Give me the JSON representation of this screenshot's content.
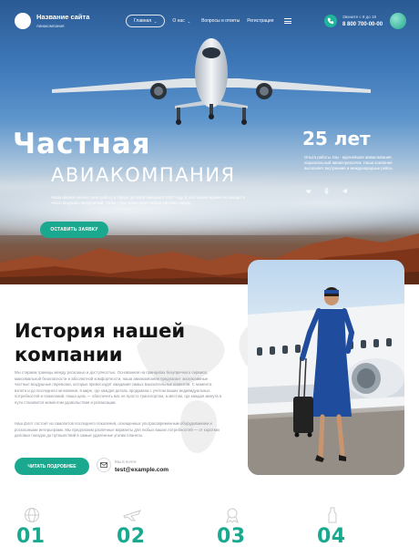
{
  "header": {
    "site_name": "Название сайта",
    "site_slogan": "Авиакомпания",
    "nav": [
      {
        "label": "Главная"
      },
      {
        "label": "О нас"
      },
      {
        "label": "Вопросы и ответы"
      },
      {
        "label": "Регистрация"
      }
    ],
    "phone_label": "Звоните с 9 до 18",
    "phone_number": "8 800 700-00-00"
  },
  "hero": {
    "title_line1": "Частная",
    "title_line2": "АВИАКОМПАНИЯ",
    "description": "Наша фирма начала свою работу в сфере деловой авиации в 2007 году. В настоящее время она входит в число ведущих предприятий. Также у нас существует гибкая система скидок.",
    "cta_label": "ОСТАВИТЬ ЗАЯВКУ",
    "years": "25 лет",
    "years_desc": "Опыта работы. Мы - крупнейшая авиакомпания, национальный авиаперевозчик. Наша компания выполняет внутренние и международные рейсы"
  },
  "history": {
    "title": "История нашей компании",
    "paragraph1": "Мы стираем границы между роскошью и доступностью. Основанная на принципах безупречного сервиса, максимальной безопасности и абсолютной комфортности, наша авиакомпания предлагает эксклюзивные частные воздушные перевозки, которые превосходят ожидания самых взыскательных клиентов. С момента взлета и до последнего мгновения, в мире, где каждая деталь продумана с учетом ваших индивидуальных потребностей и пожеланий. Наша цель — обеспечить вас не просто транспортом, а местом, где каждая минута в пути становится моментом удовольствия и релаксации.",
    "paragraph2": "Наш флот состоит из самолетов последнего поколения, оснащенных ультрасовременным оборудованием и роскошными интерьерами. Мы предлагаем различные варианты для любых ваших потребностей — от коротких деловых поездок до путешествий в самые удаленные уголки планеты.",
    "read_more_label": "ЧИТАТЬ ПОДРОБНЕЕ",
    "mail_label": "Мы в почте",
    "mail_address": "test@example.com"
  },
  "numbers": [
    {
      "value": "01",
      "icon": "globe-icon"
    },
    {
      "value": "02",
      "icon": "plane-icon"
    },
    {
      "value": "03",
      "icon": "badge-icon"
    },
    {
      "value": "04",
      "icon": "bottle-icon"
    }
  ],
  "colors": {
    "accent": "#1aa98f",
    "sky_top": "#2b5a93",
    "text_dark": "#141414",
    "text_muted": "#8a8f96"
  }
}
